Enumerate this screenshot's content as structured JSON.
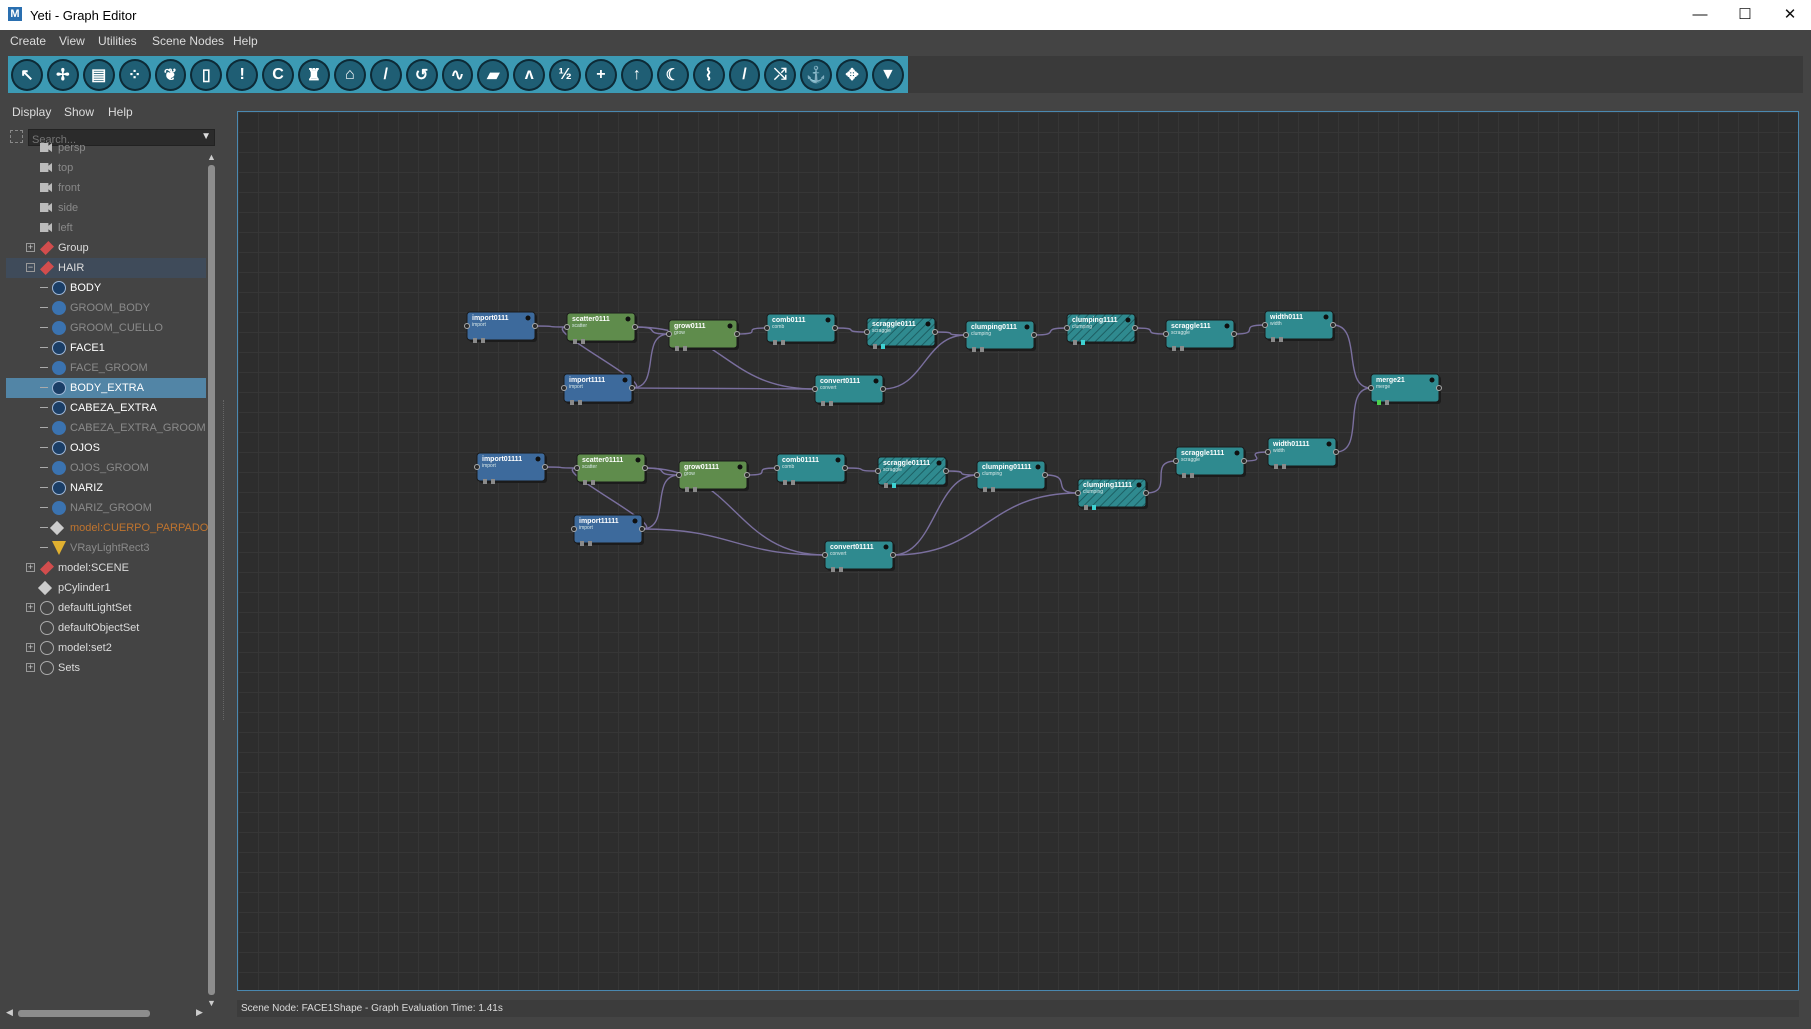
{
  "window": {
    "title": "Yeti - Graph Editor",
    "app_icon_letter": "M",
    "minimize": "—",
    "maximize": "☐",
    "close": "✕"
  },
  "menubar": [
    "Create",
    "View",
    "Utilities",
    "Scene Nodes",
    "Help"
  ],
  "toolbar": {
    "accent_color": "#3c9ab4",
    "tools": [
      {
        "icon": "pointer-icon",
        "glyph": "↖"
      },
      {
        "icon": "transform-icon",
        "glyph": "✢"
      },
      {
        "icon": "box-icon",
        "glyph": "▤"
      },
      {
        "icon": "scatter-icon",
        "glyph": "⁘"
      },
      {
        "icon": "grow-icon",
        "glyph": "❦"
      },
      {
        "icon": "cylinder-icon",
        "glyph": "▯"
      },
      {
        "icon": "exclaim-icon",
        "glyph": "!"
      },
      {
        "icon": "comb-icon",
        "glyph": "C"
      },
      {
        "icon": "guide-icon",
        "glyph": "♜"
      },
      {
        "icon": "bat-icon",
        "glyph": "⌂"
      },
      {
        "icon": "brush-icon",
        "glyph": "/"
      },
      {
        "icon": "curl-icon",
        "glyph": "↺"
      },
      {
        "icon": "wave-icon",
        "glyph": "∿"
      },
      {
        "icon": "texture-icon",
        "glyph": "▰"
      },
      {
        "icon": "peaks-icon",
        "glyph": "ʌ"
      },
      {
        "icon": "split-icon",
        "glyph": "½"
      },
      {
        "icon": "cross-icon",
        "glyph": "+"
      },
      {
        "icon": "arrow-up-icon",
        "glyph": "↑"
      },
      {
        "icon": "moon-icon",
        "glyph": "☾"
      },
      {
        "icon": "curve-icon",
        "glyph": "⌇"
      },
      {
        "icon": "pen-icon",
        "glyph": "/"
      },
      {
        "icon": "shuffle-icon",
        "glyph": "⤭"
      },
      {
        "icon": "fish-icon",
        "glyph": "⚓"
      },
      {
        "icon": "move-icon",
        "glyph": "✥"
      },
      {
        "icon": "filter-icon",
        "glyph": "▼"
      }
    ]
  },
  "outliner": {
    "menu": [
      "Display",
      "Show",
      "Help"
    ],
    "search_placeholder": "Search...",
    "items": [
      {
        "label": "persp",
        "icon": "camera-icon",
        "style": "dim",
        "expander": ""
      },
      {
        "label": "top",
        "icon": "camera-icon",
        "style": "dim",
        "expander": ""
      },
      {
        "label": "front",
        "icon": "camera-icon",
        "style": "dim",
        "expander": ""
      },
      {
        "label": "side",
        "icon": "camera-icon",
        "style": "dim",
        "expander": ""
      },
      {
        "label": "left",
        "icon": "camera-icon",
        "style": "dim",
        "expander": ""
      },
      {
        "label": "Group",
        "icon": "group-icon",
        "style": "normal",
        "expander": "+"
      },
      {
        "label": "HAIR",
        "icon": "group-icon",
        "style": "normal",
        "expander": "−",
        "state": "selected-parent"
      },
      {
        "label": "BODY",
        "icon": "yeti-node-icon",
        "style": "white",
        "child": true
      },
      {
        "label": "GROOM_BODY",
        "icon": "groom-icon",
        "style": "dim",
        "child": true
      },
      {
        "label": "GROOM_CUELLO",
        "icon": "groom-icon",
        "style": "dim",
        "child": true
      },
      {
        "label": "FACE1",
        "icon": "yeti-node-icon",
        "style": "white",
        "child": true
      },
      {
        "label": "FACE_GROOM",
        "icon": "groom-icon",
        "style": "dim",
        "child": true
      },
      {
        "label": "BODY_EXTRA",
        "icon": "yeti-node-icon",
        "style": "white",
        "child": true,
        "state": "selected"
      },
      {
        "label": "CABEZA_EXTRA",
        "icon": "yeti-node-icon",
        "style": "white",
        "child": true
      },
      {
        "label": "CABEZA_EXTRA_GROOM",
        "icon": "groom-icon",
        "style": "dim",
        "child": true
      },
      {
        "label": "OJOS",
        "icon": "yeti-node-icon",
        "style": "white",
        "child": true
      },
      {
        "label": "OJOS_GROOM",
        "icon": "groom-icon",
        "style": "dim",
        "child": true
      },
      {
        "label": "NARIZ",
        "icon": "yeti-node-icon",
        "style": "white",
        "child": true
      },
      {
        "label": "NARIZ_GROOM",
        "icon": "groom-icon",
        "style": "dim",
        "child": true
      },
      {
        "label": "model:CUERPO_PARPADO",
        "icon": "mesh-icon",
        "style": "orange",
        "child": true
      },
      {
        "label": "VRayLightRect3",
        "icon": "light-icon",
        "style": "dim",
        "child": true
      },
      {
        "label": "model:SCENE",
        "icon": "group-icon",
        "style": "normal",
        "expander": "+"
      },
      {
        "label": "pCylinder1",
        "icon": "mesh-icon",
        "style": "normal",
        "expander": ""
      },
      {
        "label": "defaultLightSet",
        "icon": "set-icon",
        "style": "normal",
        "expander": "+"
      },
      {
        "label": "defaultObjectSet",
        "icon": "set-icon",
        "style": "normal",
        "expander": ""
      },
      {
        "label": "model:set2",
        "icon": "set-icon",
        "style": "normal",
        "expander": "+"
      },
      {
        "label": "Sets",
        "icon": "set-icon",
        "style": "normal",
        "expander": "+"
      }
    ]
  },
  "graph": {
    "colors": {
      "import": "#3d6a9c",
      "generator": "#5f8c4c",
      "op": "#2f8a8f",
      "wire": "#7a6f9e"
    },
    "nodes": [
      {
        "id": "import0111",
        "label": "import0111",
        "sub": "import",
        "kind": "import",
        "icon": "pointer-icon"
      },
      {
        "id": "scatter0111",
        "label": "scatter0111",
        "sub": "scatter",
        "kind": "generator",
        "icon": "scatter-icon"
      },
      {
        "id": "grow0111",
        "label": "grow0111",
        "sub": "grow",
        "kind": "generator",
        "icon": "grow-icon"
      },
      {
        "id": "comb0111",
        "label": "comb0111",
        "sub": "comb",
        "kind": "op",
        "icon": "comb-icon"
      },
      {
        "id": "scraggle0111",
        "label": "scraggle0111",
        "sub": "scraggle",
        "kind": "op",
        "hatched": true,
        "icon": "scraggle-icon"
      },
      {
        "id": "clumping0111",
        "label": "clumping0111",
        "sub": "clumping",
        "kind": "op",
        "icon": "clump-icon"
      },
      {
        "id": "clumping1111",
        "label": "clumping1111",
        "sub": "clumping",
        "kind": "op",
        "hatched": true,
        "icon": "clump-icon"
      },
      {
        "id": "scraggle111",
        "label": "scraggle111",
        "sub": "scraggle",
        "kind": "op",
        "icon": "scraggle-icon"
      },
      {
        "id": "width0111",
        "label": "width0111",
        "sub": "width",
        "kind": "op",
        "icon": "width-icon"
      },
      {
        "id": "import1111",
        "label": "import1111",
        "sub": "import",
        "kind": "import",
        "icon": "pointer-icon"
      },
      {
        "id": "convert0111",
        "label": "convert0111",
        "sub": "convert",
        "kind": "op",
        "icon": "convert-icon"
      },
      {
        "id": "merge21",
        "label": "merge21",
        "sub": "merge",
        "kind": "op",
        "icon": "merge-icon"
      },
      {
        "id": "import01111",
        "label": "import01111",
        "sub": "import",
        "kind": "import",
        "icon": "pointer-icon"
      },
      {
        "id": "scatter01111",
        "label": "scatter01111",
        "sub": "scatter",
        "kind": "generator",
        "icon": "scatter-icon"
      },
      {
        "id": "grow01111",
        "label": "grow01111",
        "sub": "grow",
        "kind": "generator",
        "icon": "grow-icon"
      },
      {
        "id": "comb01111",
        "label": "comb01111",
        "sub": "comb",
        "kind": "op",
        "icon": "comb-icon"
      },
      {
        "id": "scraggle01111",
        "label": "scraggle01111",
        "sub": "scraggle",
        "kind": "op",
        "hatched": true,
        "icon": "scraggle-icon"
      },
      {
        "id": "clumping01111",
        "label": "clumping01111",
        "sub": "clumping",
        "kind": "op",
        "icon": "clump-icon"
      },
      {
        "id": "clumping11111",
        "label": "clumping11111",
        "sub": "clumping",
        "kind": "op",
        "hatched": true,
        "icon": "clump-icon"
      },
      {
        "id": "scraggle1111",
        "label": "scraggle1111",
        "sub": "scraggle",
        "kind": "op",
        "icon": "scraggle-icon"
      },
      {
        "id": "width01111",
        "label": "width01111",
        "sub": "width",
        "kind": "op",
        "icon": "width-icon"
      },
      {
        "id": "import11111",
        "label": "import11111",
        "sub": "import",
        "kind": "import",
        "icon": "pointer-icon"
      },
      {
        "id": "convert01111",
        "label": "convert01111",
        "sub": "convert",
        "kind": "op",
        "icon": "convert-icon"
      }
    ],
    "edges": [
      [
        "import0111",
        "scatter0111"
      ],
      [
        "scatter0111",
        "grow0111"
      ],
      [
        "grow0111",
        "comb0111"
      ],
      [
        "comb0111",
        "scraggle0111"
      ],
      [
        "scraggle0111",
        "clumping0111"
      ],
      [
        "clumping0111",
        "clumping1111"
      ],
      [
        "clumping1111",
        "scraggle111"
      ],
      [
        "scraggle111",
        "width0111"
      ],
      [
        "width0111",
        "merge21"
      ],
      [
        "import1111",
        "grow0111"
      ],
      [
        "import1111",
        "convert0111"
      ],
      [
        "scatter0111",
        "convert0111"
      ],
      [
        "convert0111",
        "clumping0111"
      ],
      [
        "import1111",
        "scatter0111"
      ],
      [
        "import01111",
        "scatter01111"
      ],
      [
        "scatter01111",
        "grow01111"
      ],
      [
        "grow01111",
        "comb01111"
      ],
      [
        "comb01111",
        "scraggle01111"
      ],
      [
        "scraggle01111",
        "clumping01111"
      ],
      [
        "clumping01111",
        "clumping11111"
      ],
      [
        "clumping11111",
        "scraggle1111"
      ],
      [
        "scraggle1111",
        "width01111"
      ],
      [
        "width01111",
        "merge21"
      ],
      [
        "import11111",
        "grow01111"
      ],
      [
        "import11111",
        "convert01111"
      ],
      [
        "scatter01111",
        "convert01111"
      ],
      [
        "convert01111",
        "clumping01111"
      ],
      [
        "convert01111",
        "clumping11111"
      ],
      [
        "import11111",
        "scatter01111"
      ]
    ]
  },
  "status": {
    "text": "Scene Node: FACE1Shape - Graph Evaluation Time: 1.41s"
  }
}
